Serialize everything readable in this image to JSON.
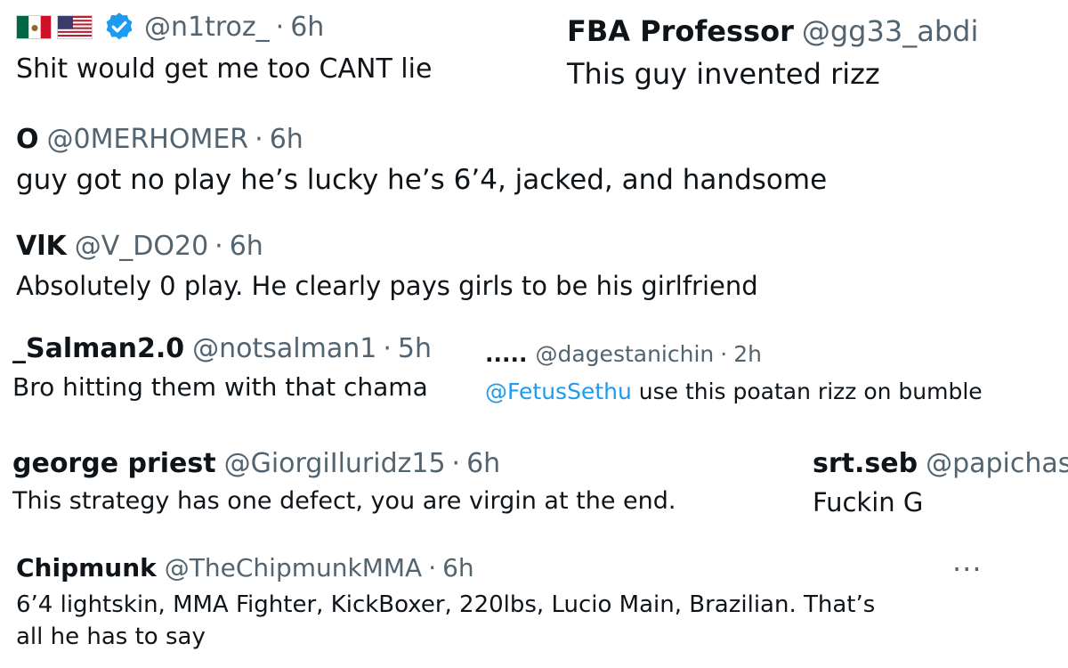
{
  "tweets": [
    {
      "name": "",
      "handle": "@n1troz_",
      "time": "6h",
      "text": "Shit would get me too CANT lie",
      "flags": [
        "mexico-flag-icon",
        "usa-flag-icon"
      ],
      "verified": true
    },
    {
      "name": "FBA Professor",
      "handle": "@gg33_abdi",
      "time": "",
      "text": "This guy invented rizz"
    },
    {
      "name": "O",
      "handle": "@0MERHOMER",
      "time": "6h",
      "text": "guy got no play he’s lucky he’s 6’4, jacked, and handsome"
    },
    {
      "name": "VlK",
      "handle": "@V_DO20",
      "time": "6h",
      "text": "Absolutely 0 play. He clearly pays girls to be his girlfriend"
    },
    {
      "name": "_Salman2.0",
      "handle": "@notsalman1",
      "time": "5h",
      "text": "Bro hitting them with that chama"
    },
    {
      "name": ".....",
      "handle": "@dagestanichin",
      "time": "2h",
      "mention": "@FetusSethu",
      "text": " use this poatan rizz on bumble"
    },
    {
      "name": "george priest",
      "handle": "@GiorgiIluridz15",
      "time": "6h",
      "text": "This strategy has one defect, you are virgin at the end."
    },
    {
      "name": "srt.seb",
      "handle": "@papichas",
      "time": "",
      "text": "Fuckin G"
    },
    {
      "name": "Chipmunk",
      "handle": "@TheChipmunkMMA",
      "time": "6h",
      "text_line1": "6’4 lightskin, MMA Fighter, KickBoxer, 220lbs, Lucio Main, Brazilian. That’s",
      "text_line2": "all he has to say"
    }
  ],
  "separator": "·",
  "more_label": "···",
  "colors": {
    "name": "#0f1419",
    "secondary": "#536471",
    "link": "#1d9bf0",
    "verified": "#1d9bf0"
  }
}
